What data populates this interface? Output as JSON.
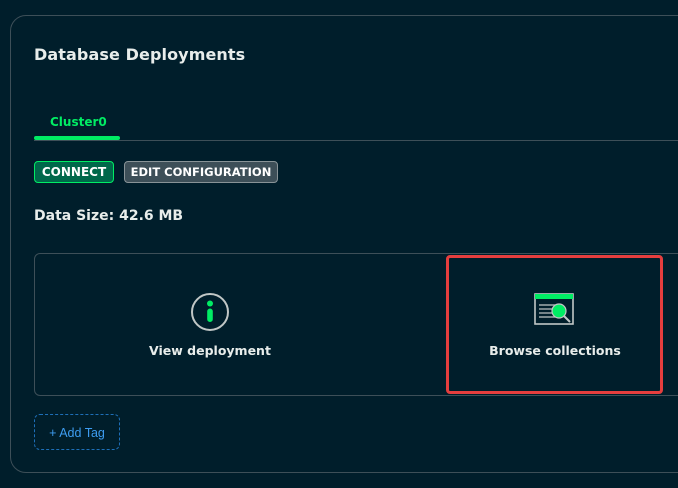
{
  "section": {
    "title": "Database Deployments"
  },
  "tabs": [
    {
      "label": "Cluster0",
      "active": true
    }
  ],
  "actions": {
    "connect_label": "CONNECT",
    "edit_label": "EDIT CONFIGURATION"
  },
  "data_size": {
    "text": "Data Size: 42.6 MB"
  },
  "cards": {
    "view": {
      "label": "View deployment",
      "icon": "info-icon"
    },
    "browse": {
      "label": "Browse collections",
      "icon": "collections-browser-icon"
    }
  },
  "tags": {
    "add_label": "+ Add Tag"
  },
  "colors": {
    "background": "#001e2b",
    "accent": "#00ed64",
    "highlight": "#e53e3e",
    "link": "#3d9cf0"
  }
}
